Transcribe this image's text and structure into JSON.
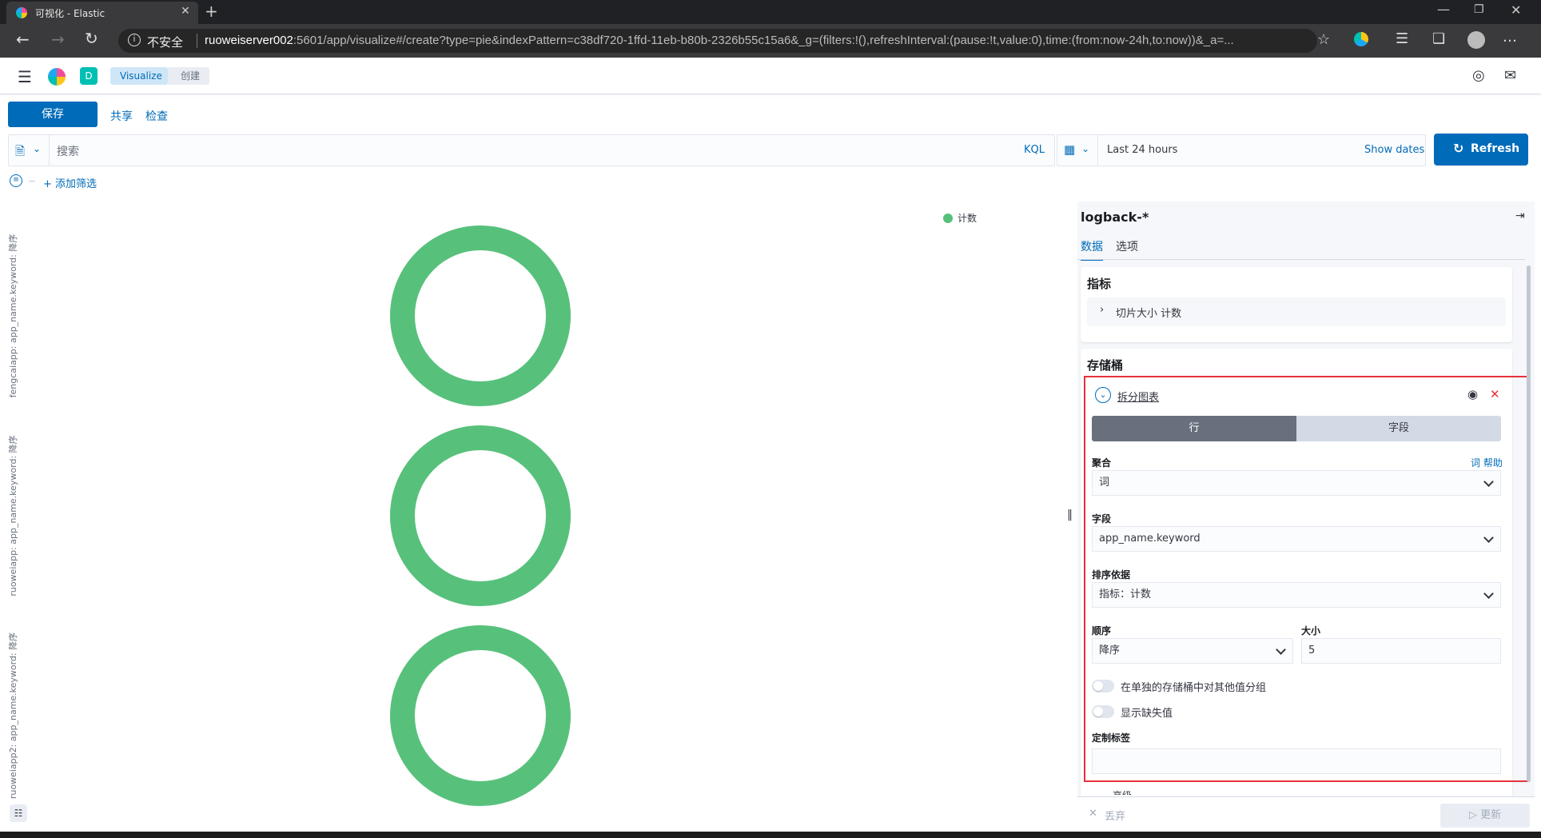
{
  "browser": {
    "tab_title": "可视化 - Elastic",
    "security_label": "不安全",
    "url_host": "ruoweiserver002",
    "url_rest": ":5601/app/visualize#/create?type=pie&indexPattern=c38df720-1ffd-11eb-b80b-2326b55c15a6&_g=(filters:!(),refreshInterval:(pause:!t,value:0),time:(from:now-24h,to:now))&_a=..."
  },
  "header": {
    "space_avatar": "D",
    "breadcrumbs": [
      "Visualize",
      "创建"
    ]
  },
  "toolbar": {
    "save": "保存",
    "share": "共享",
    "inspect": "检查"
  },
  "query": {
    "placeholder": "搜索",
    "language": "KQL"
  },
  "time": {
    "range": "Last 24 hours",
    "show_dates": "Show dates",
    "refresh": "Refresh"
  },
  "filters": {
    "add": "+ 添加筛选"
  },
  "chart_data": {
    "type": "pie",
    "legend": [
      "计数"
    ],
    "legend_position": "top-right",
    "color": "#57c17b",
    "rows": [
      {
        "label": "fengcaiapp: app_name.keyword: 降序",
        "slices": [
          {
            "name": "计数",
            "value": 100
          }
        ]
      },
      {
        "label": "ruoweiapp: app_name.keyword: 降序",
        "slices": [
          {
            "name": "计数",
            "value": 100
          }
        ]
      },
      {
        "label": "ruoweiapp2: app_name.keyword: 降序",
        "slices": [
          {
            "name": "计数",
            "value": 100
          }
        ]
      }
    ]
  },
  "sidebar": {
    "index_pattern": "logback-*",
    "tabs": [
      "数据",
      "选项"
    ],
    "metrics_title": "指标",
    "metric_item": "切片大小 计数",
    "buckets_title": "存储桶",
    "bucket_name": "拆分图表",
    "split_toggle": [
      "行",
      "字段"
    ],
    "agg_label": "聚合",
    "agg_help": "词 帮助",
    "agg_value": "词",
    "field_label": "字段",
    "field_value": "app_name.keyword",
    "order_by_label": "排序依据",
    "order_by_value": "指标：计数",
    "order_label": "顺序",
    "order_value": "降序",
    "size_label": "大小",
    "size_value": "5",
    "other_bucket": "在单独的存储桶中对其他值分组",
    "missing": "显示缺失值",
    "custom_label": "定制标签",
    "advanced": "高级",
    "discard": "丢弃",
    "update": "更新"
  },
  "colors": {
    "accent": "#006bb8",
    "highlight_box": "#e7323c",
    "pie": "#57c17b"
  }
}
